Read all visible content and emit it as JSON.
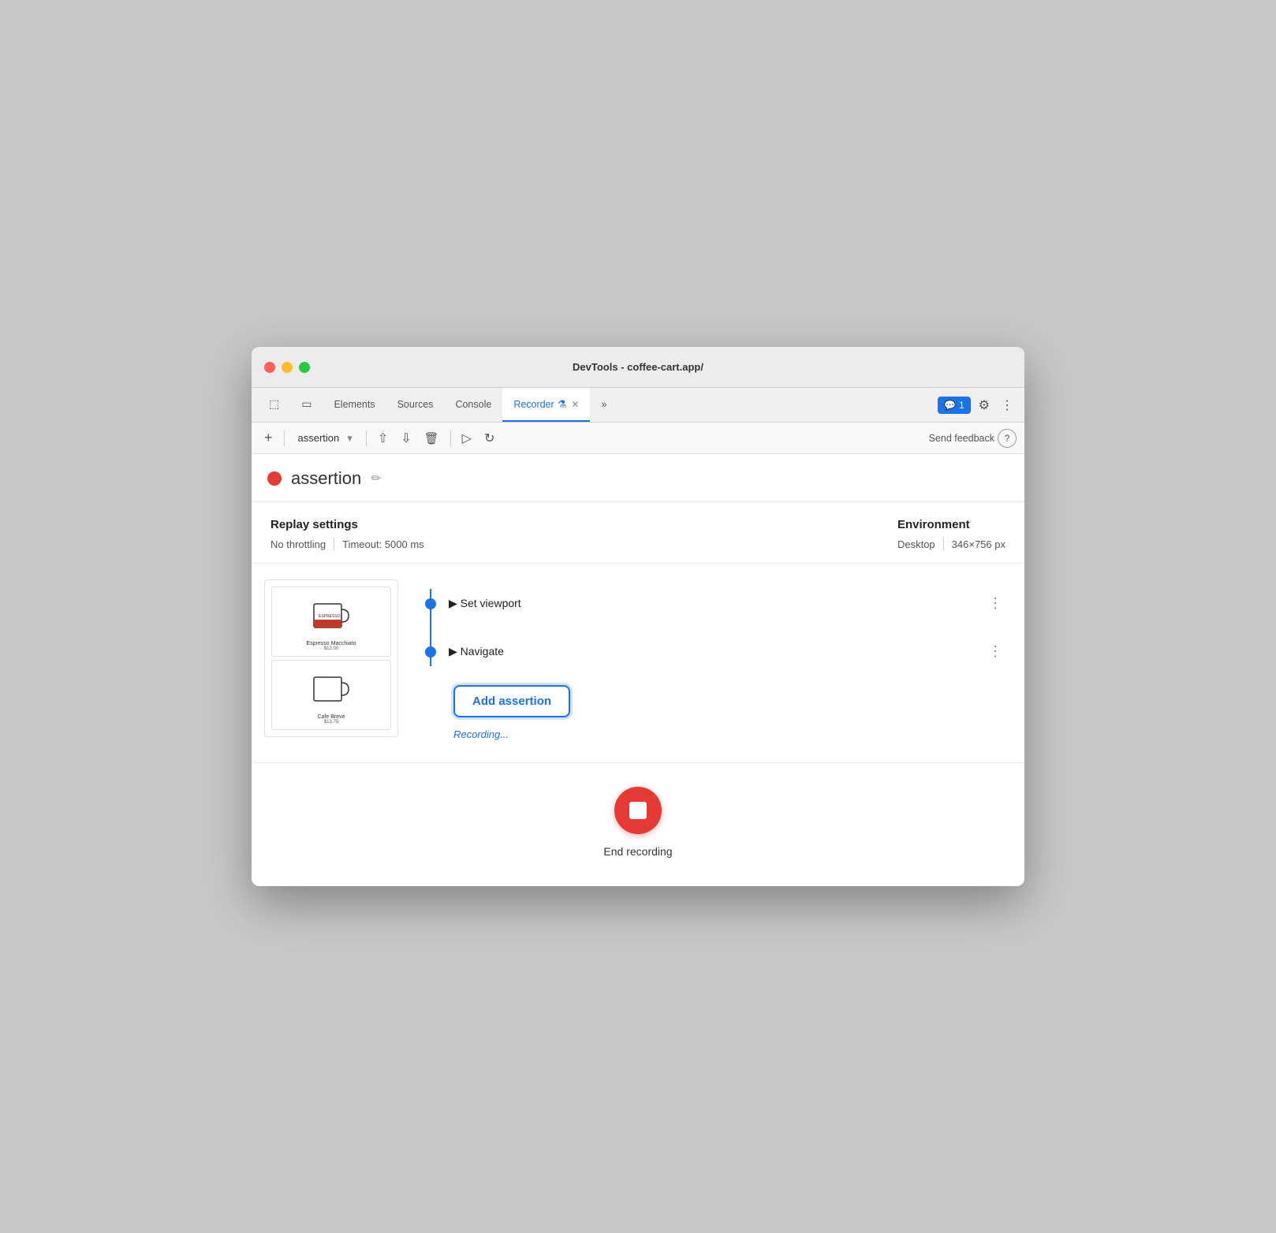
{
  "window": {
    "title": "DevTools - coffee-cart.app/"
  },
  "tabs": [
    {
      "id": "elements",
      "label": "Elements",
      "active": false
    },
    {
      "id": "sources",
      "label": "Sources",
      "active": false
    },
    {
      "id": "console",
      "label": "Console",
      "active": false
    },
    {
      "id": "recorder",
      "label": "Recorder",
      "active": true
    },
    {
      "id": "more",
      "label": "»",
      "active": false
    }
  ],
  "header_right": {
    "badge_count": "1",
    "gear_label": "⚙",
    "more_label": "⋮"
  },
  "toolbar": {
    "add_label": "+",
    "recording_name": "assertion",
    "chevron": "▾",
    "export_label": "↑",
    "download_label": "↓",
    "delete_label": "🗑",
    "play_label": "▷",
    "replay_label": "↻",
    "send_feedback": "Send feedback",
    "help_label": "?"
  },
  "recording": {
    "title": "assertion",
    "edit_icon": "✏"
  },
  "replay_settings": {
    "title": "Replay settings",
    "throttle": "No throttling",
    "timeout": "Timeout: 5000 ms",
    "env_title": "Environment",
    "env_preset": "Desktop",
    "env_size": "346×756 px"
  },
  "steps": [
    {
      "id": "set-viewport",
      "label": "▶ Set viewport"
    },
    {
      "id": "navigate",
      "label": "▶ Navigate"
    }
  ],
  "add_assertion": {
    "button_label": "Add assertion",
    "recording_status": "Recording..."
  },
  "end_recording": {
    "label": "End recording"
  },
  "mug1": {
    "label": "Espresso Macchiato",
    "price": "$12.00"
  },
  "mug2": {
    "label": "Cafe Breve",
    "price": "$13.75"
  }
}
